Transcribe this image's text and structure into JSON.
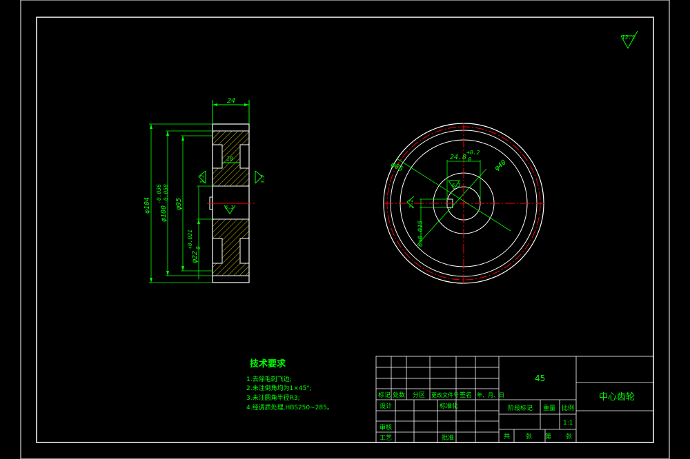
{
  "colors": {
    "background": "#000000",
    "frame": "#ffffff",
    "dimension": "#00ff00",
    "centerline": "#ff0000",
    "hatch": "#ffff00"
  },
  "roughness_global": "12.5",
  "side_view": {
    "width_dim": "24",
    "dia_outer": "φ104",
    "dia_tip": "φ100",
    "tol_tip_upper": "-0.036",
    "tol_tip_lower": "-0.058",
    "dia_hub": "φ95",
    "dia_bore": "φ22",
    "tol_bore_upper": "+0.021",
    "tol_bore_lower": "0",
    "web_dim": "10",
    "rough_left": "3.2",
    "rough_right": "3.2",
    "rough_bore": "6.3"
  },
  "front_view": {
    "key_dim": "24.8",
    "key_tol_upper": "+0.2",
    "key_tol_lower": "0",
    "dia_40": "φ40",
    "dia_86": "φ86",
    "rough_key": "6.3",
    "rough_keyside": "3.2",
    "key_width": "6±0.015"
  },
  "tech_requirements": {
    "title": "技术要求",
    "items": [
      "1.去除毛刺飞边;",
      "2.未注倒角均为1×45°;",
      "3.未注圆角半径R3;",
      "4.经调质处理,HBS250~285。"
    ]
  },
  "title_block": {
    "material": "45",
    "part_name": "中心齿轮",
    "row_labels": [
      "标记",
      "处数",
      "分区",
      "更改文件号",
      "签名",
      "年、月、日"
    ],
    "designer": "设计",
    "standardization": "标准化",
    "checker": "审核",
    "process": "工艺",
    "approve": "批准",
    "stage_mark": "阶段标记",
    "weight": "重量",
    "scale_label": "比例",
    "scale": "1:1",
    "total": "共",
    "sheet": "张",
    "page": "第",
    "sheet2": "张"
  }
}
